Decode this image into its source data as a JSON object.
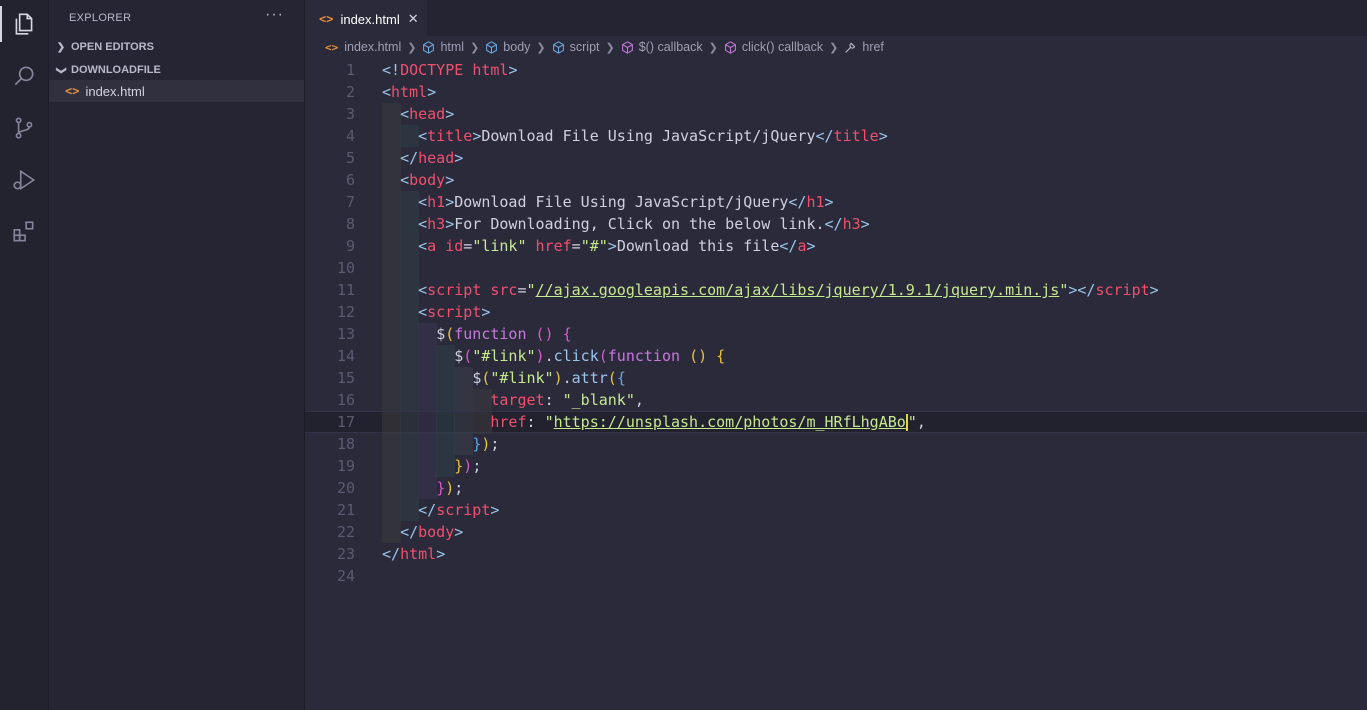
{
  "sidebar": {
    "title": "EXPLORER",
    "more": "···",
    "sections": [
      {
        "label": "OPEN EDITORS",
        "collapsed": true
      },
      {
        "label": "DOWNLOADFILE",
        "collapsed": false
      }
    ],
    "file": {
      "icon": "<>",
      "name": "index.html"
    }
  },
  "activity_icons": [
    "files-icon",
    "search-icon",
    "source-control-icon",
    "run-debug-icon",
    "extensions-icon"
  ],
  "tab": {
    "icon": "<>",
    "label": "index.html",
    "close": "✕"
  },
  "breadcrumb": {
    "file": "index.html",
    "items": [
      "html",
      "body",
      "script",
      "$() callback",
      "click() callback",
      "href"
    ]
  },
  "editor": {
    "current_line": 17,
    "lines": [
      [
        [
          "b",
          "<!"
        ],
        [
          "t",
          "DOCTYPE"
        ],
        [
          "x",
          " "
        ],
        [
          "a",
          "html"
        ],
        [
          "b",
          ">"
        ]
      ],
      [
        [
          "b",
          "<"
        ],
        [
          "t",
          "html"
        ],
        [
          "b",
          ">"
        ]
      ],
      [
        [
          "x",
          "  "
        ],
        [
          "b",
          "<"
        ],
        [
          "t",
          "head"
        ],
        [
          "b",
          ">"
        ]
      ],
      [
        [
          "x",
          "    "
        ],
        [
          "b",
          "<"
        ],
        [
          "t",
          "title"
        ],
        [
          "b",
          ">"
        ],
        [
          "x",
          "Download File Using JavaScript/jQuery"
        ],
        [
          "b",
          "</"
        ],
        [
          "t",
          "title"
        ],
        [
          "b",
          ">"
        ]
      ],
      [
        [
          "x",
          "  "
        ],
        [
          "b",
          "</"
        ],
        [
          "t",
          "head"
        ],
        [
          "b",
          ">"
        ]
      ],
      [
        [
          "x",
          "  "
        ],
        [
          "b",
          "<"
        ],
        [
          "t",
          "body"
        ],
        [
          "b",
          ">"
        ]
      ],
      [
        [
          "x",
          "    "
        ],
        [
          "b",
          "<"
        ],
        [
          "t",
          "h1"
        ],
        [
          "b",
          ">"
        ],
        [
          "x",
          "Download File Using JavaScript/jQuery"
        ],
        [
          "b",
          "</"
        ],
        [
          "t",
          "h1"
        ],
        [
          "b",
          ">"
        ]
      ],
      [
        [
          "x",
          "    "
        ],
        [
          "b",
          "<"
        ],
        [
          "t",
          "h3"
        ],
        [
          "b",
          ">"
        ],
        [
          "x",
          "For Downloading, Click on the below link."
        ],
        [
          "b",
          "</"
        ],
        [
          "t",
          "h3"
        ],
        [
          "b",
          ">"
        ]
      ],
      [
        [
          "x",
          "    "
        ],
        [
          "b",
          "<"
        ],
        [
          "t",
          "a"
        ],
        [
          "x",
          " "
        ],
        [
          "a",
          "id"
        ],
        [
          "x",
          "="
        ],
        [
          "s",
          "\"link\""
        ],
        [
          "x",
          " "
        ],
        [
          "a",
          "href"
        ],
        [
          "x",
          "="
        ],
        [
          "s",
          "\"#\""
        ],
        [
          "b",
          ">"
        ],
        [
          "x",
          "Download this file"
        ],
        [
          "b",
          "</"
        ],
        [
          "t",
          "a"
        ],
        [
          "b",
          ">"
        ]
      ],
      [],
      [
        [
          "x",
          "    "
        ],
        [
          "b",
          "<"
        ],
        [
          "t",
          "script"
        ],
        [
          "x",
          " "
        ],
        [
          "a",
          "src"
        ],
        [
          "x",
          "="
        ],
        [
          "s",
          "\""
        ],
        [
          "l",
          "//ajax.googleapis.com/ajax/libs/jquery/1.9.1/jquery.min.js"
        ],
        [
          "s",
          "\""
        ],
        [
          "b",
          "></"
        ],
        [
          "t",
          "script"
        ],
        [
          "b",
          ">"
        ]
      ],
      [
        [
          "x",
          "    "
        ],
        [
          "b",
          "<"
        ],
        [
          "t",
          "script"
        ],
        [
          "b",
          ">"
        ]
      ],
      [
        [
          "x",
          "      "
        ],
        [
          "p",
          "$"
        ],
        [
          "y",
          "("
        ],
        [
          "k",
          "function"
        ],
        [
          "x",
          " "
        ],
        [
          "m",
          "()"
        ],
        [
          "x",
          " "
        ],
        [
          "m",
          "{"
        ]
      ],
      [
        [
          "x",
          "        "
        ],
        [
          "p",
          "$"
        ],
        [
          "m",
          "("
        ],
        [
          "s",
          "\"#link\""
        ],
        [
          "m",
          ")"
        ],
        [
          "p",
          "."
        ],
        [
          "f",
          "click"
        ],
        [
          "m",
          "("
        ],
        [
          "k",
          "function"
        ],
        [
          "x",
          " "
        ],
        [
          "y",
          "()"
        ],
        [
          "x",
          " "
        ],
        [
          "y",
          "{"
        ]
      ],
      [
        [
          "x",
          "          "
        ],
        [
          "p",
          "$"
        ],
        [
          "y",
          "("
        ],
        [
          "s",
          "\"#link\""
        ],
        [
          "y",
          ")"
        ],
        [
          "p",
          "."
        ],
        [
          "f",
          "attr"
        ],
        [
          "y",
          "("
        ],
        [
          "bb",
          "{"
        ]
      ],
      [
        [
          "x",
          "            "
        ],
        [
          "a",
          "target"
        ],
        [
          "p",
          ":"
        ],
        [
          "x",
          " "
        ],
        [
          "s",
          "\"_blank\""
        ],
        [
          "p",
          ","
        ]
      ],
      [
        [
          "x",
          "            "
        ],
        [
          "a",
          "href"
        ],
        [
          "p",
          ":"
        ],
        [
          "x",
          " "
        ],
        [
          "s",
          "\""
        ],
        [
          "l",
          "https://unsplash.com/photos/m_HRfLhgABo"
        ],
        [
          "c",
          ""
        ],
        [
          "s",
          "\""
        ],
        [
          "p",
          ","
        ]
      ],
      [
        [
          "x",
          "          "
        ],
        [
          "bb",
          "}"
        ],
        [
          "y",
          ")"
        ],
        [
          "p",
          ";"
        ]
      ],
      [
        [
          "x",
          "        "
        ],
        [
          "y",
          "}"
        ],
        [
          "m",
          ")"
        ],
        [
          "p",
          ";"
        ]
      ],
      [
        [
          "x",
          "      "
        ],
        [
          "m",
          "}"
        ],
        [
          "y",
          ")"
        ],
        [
          "p",
          ";"
        ]
      ],
      [
        [
          "x",
          "    "
        ],
        [
          "b",
          "</"
        ],
        [
          "t",
          "script"
        ],
        [
          "b",
          ">"
        ]
      ],
      [
        [
          "x",
          "  "
        ],
        [
          "b",
          "</"
        ],
        [
          "t",
          "body"
        ],
        [
          "b",
          ">"
        ]
      ],
      [
        [
          "b",
          "</"
        ],
        [
          "t",
          "html"
        ],
        [
          "b",
          ">"
        ]
      ],
      []
    ]
  },
  "colors": {
    "background": "#2b2a3b",
    "tag": "#f0506e",
    "string": "#c6e88f",
    "bracket": "#9bc4e8",
    "keyword": "#c678dd",
    "file_icon": "#e8903c"
  }
}
